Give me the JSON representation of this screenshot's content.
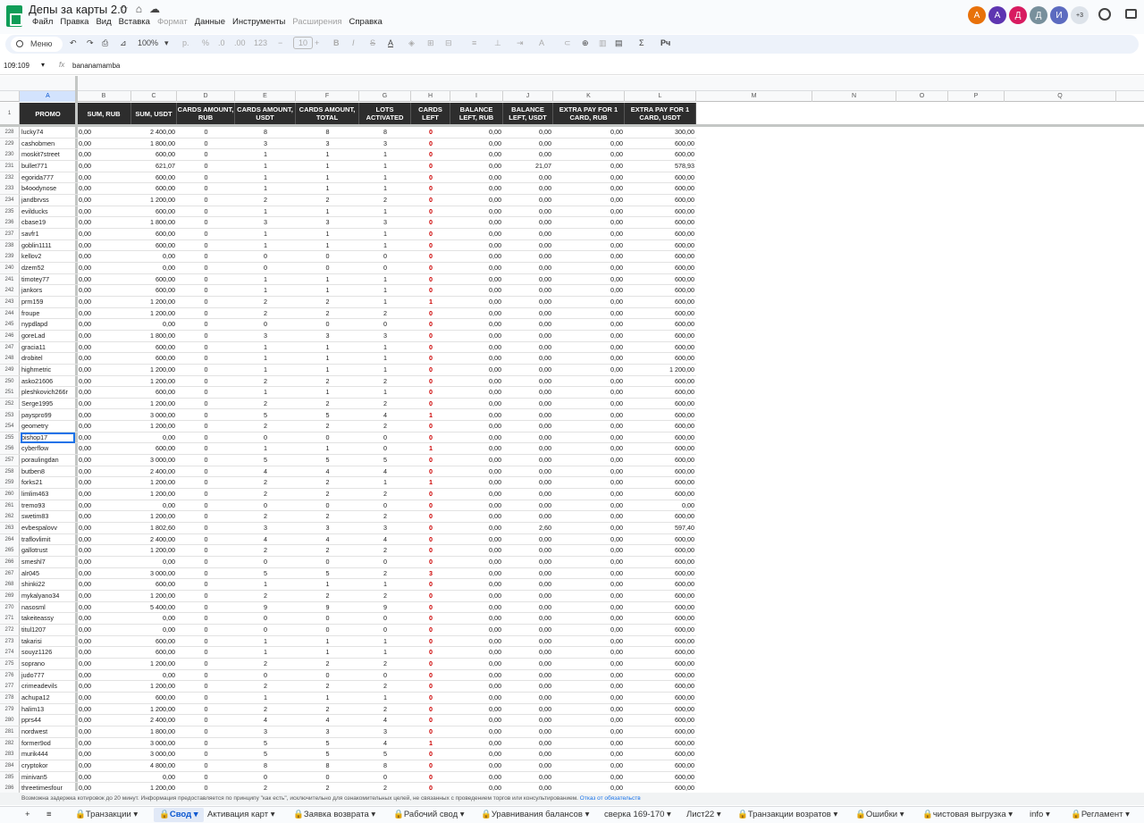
{
  "doc": {
    "title": "Депы за карты 2.0"
  },
  "menu": [
    "Файл",
    "Правка",
    "Вид",
    "Вставка",
    "Формат",
    "Данные",
    "Инструменты",
    "Расширения",
    "Справка"
  ],
  "menu_disabled": [
    "Формат",
    "Расширения"
  ],
  "avatars": [
    {
      "letter": "A",
      "color": "#e8710a"
    },
    {
      "letter": "A",
      "color": "#5e35b1"
    },
    {
      "letter": "Д",
      "color": "#d81b60"
    },
    {
      "letter": "Д",
      "color": "#78909c"
    },
    {
      "letter": "И",
      "color": "#5c6bc0"
    },
    {
      "letter": "+3",
      "color": "#dde3ea"
    }
  ],
  "toolbar": {
    "search_label": "Меню",
    "zoom": "100%",
    "currency": "р.",
    "percent": "%",
    "dec_dec": ".0",
    "inc_dec": ".00",
    "format_123": "123",
    "font_size": "10",
    "functions": "Σ",
    "input_tools": "Рч"
  },
  "formula_bar": {
    "name_box": "109:109",
    "fx": "fx",
    "value": "bananamamba"
  },
  "columns": [
    "A",
    "B",
    "C",
    "D",
    "E",
    "F",
    "G",
    "H",
    "I",
    "J",
    "K",
    "L",
    "M",
    "N",
    "O",
    "P",
    "Q"
  ],
  "header_row_number": "1",
  "headers": [
    "PROMO",
    "SUM, RUB",
    "SUM, USDT",
    "CARDS AMOUNT, RUB",
    "CARDS AMOUNT, USDT",
    "CARDS AMOUNT, TOTAL",
    "LOTS ACTIVATED",
    "CARDS LEFT",
    "BALANCE LEFT, RUB",
    "BALANCE LEFT, USDT",
    "EXTRA PAY FOR 1 CARD, RUB",
    "EXTRA PAY FOR 1 CARD, USDT"
  ],
  "rows": [
    [
      "228",
      "lucky74",
      "0,00",
      "2 400,00",
      "0",
      "8",
      "8",
      "8",
      "0",
      "0,00",
      "0,00",
      "0,00",
      "300,00"
    ],
    [
      "229",
      "cashobmen",
      "0,00",
      "1 800,00",
      "0",
      "3",
      "3",
      "3",
      "0",
      "0,00",
      "0,00",
      "0,00",
      "600,00"
    ],
    [
      "230",
      "moskit7street",
      "0,00",
      "600,00",
      "0",
      "1",
      "1",
      "1",
      "0",
      "0,00",
      "0,00",
      "0,00",
      "600,00"
    ],
    [
      "231",
      "bullet771",
      "0,00",
      "621,07",
      "0",
      "1",
      "1",
      "1",
      "0",
      "0,00",
      "21,07",
      "0,00",
      "578,93"
    ],
    [
      "232",
      "egorida777",
      "0,00",
      "600,00",
      "0",
      "1",
      "1",
      "1",
      "0",
      "0,00",
      "0,00",
      "0,00",
      "600,00"
    ],
    [
      "233",
      "b4oodynose",
      "0,00",
      "600,00",
      "0",
      "1",
      "1",
      "1",
      "0",
      "0,00",
      "0,00",
      "0,00",
      "600,00"
    ],
    [
      "234",
      "jandbrvss",
      "0,00",
      "1 200,00",
      "0",
      "2",
      "2",
      "2",
      "0",
      "0,00",
      "0,00",
      "0,00",
      "600,00"
    ],
    [
      "235",
      "evilducks",
      "0,00",
      "600,00",
      "0",
      "1",
      "1",
      "1",
      "0",
      "0,00",
      "0,00",
      "0,00",
      "600,00"
    ],
    [
      "236",
      "cbase19",
      "0,00",
      "1 800,00",
      "0",
      "3",
      "3",
      "3",
      "0",
      "0,00",
      "0,00",
      "0,00",
      "600,00"
    ],
    [
      "237",
      "savfr1",
      "0,00",
      "600,00",
      "0",
      "1",
      "1",
      "1",
      "0",
      "0,00",
      "0,00",
      "0,00",
      "600,00"
    ],
    [
      "238",
      "goblin1111",
      "0,00",
      "600,00",
      "0",
      "1",
      "1",
      "1",
      "0",
      "0,00",
      "0,00",
      "0,00",
      "600,00"
    ],
    [
      "239",
      "kellov2",
      "0,00",
      "0,00",
      "0",
      "0",
      "0",
      "0",
      "0",
      "0,00",
      "0,00",
      "0,00",
      "600,00"
    ],
    [
      "240",
      "dzem52",
      "0,00",
      "0,00",
      "0",
      "0",
      "0",
      "0",
      "0",
      "0,00",
      "0,00",
      "0,00",
      "600,00"
    ],
    [
      "241",
      "timotey77",
      "0,00",
      "600,00",
      "0",
      "1",
      "1",
      "1",
      "0",
      "0,00",
      "0,00",
      "0,00",
      "600,00"
    ],
    [
      "242",
      "jankors",
      "0,00",
      "600,00",
      "0",
      "1",
      "1",
      "1",
      "0",
      "0,00",
      "0,00",
      "0,00",
      "600,00"
    ],
    [
      "243",
      "prm159",
      "0,00",
      "1 200,00",
      "0",
      "2",
      "2",
      "1",
      "1",
      "0,00",
      "0,00",
      "0,00",
      "600,00"
    ],
    [
      "244",
      "froupe",
      "0,00",
      "1 200,00",
      "0",
      "2",
      "2",
      "2",
      "0",
      "0,00",
      "0,00",
      "0,00",
      "600,00"
    ],
    [
      "245",
      "nypdlapd",
      "0,00",
      "0,00",
      "0",
      "0",
      "0",
      "0",
      "0",
      "0,00",
      "0,00",
      "0,00",
      "600,00"
    ],
    [
      "246",
      "goreLad",
      "0,00",
      "1 800,00",
      "0",
      "3",
      "3",
      "3",
      "0",
      "0,00",
      "0,00",
      "0,00",
      "600,00"
    ],
    [
      "247",
      "gracia11",
      "0,00",
      "600,00",
      "0",
      "1",
      "1",
      "1",
      "0",
      "0,00",
      "0,00",
      "0,00",
      "600,00"
    ],
    [
      "248",
      "drobitel",
      "0,00",
      "600,00",
      "0",
      "1",
      "1",
      "1",
      "0",
      "0,00",
      "0,00",
      "0,00",
      "600,00"
    ],
    [
      "249",
      "highmetric",
      "0,00",
      "1 200,00",
      "0",
      "1",
      "1",
      "1",
      "0",
      "0,00",
      "0,00",
      "0,00",
      "1 200,00"
    ],
    [
      "250",
      "asko21606",
      "0,00",
      "1 200,00",
      "0",
      "2",
      "2",
      "2",
      "0",
      "0,00",
      "0,00",
      "0,00",
      "600,00"
    ],
    [
      "251",
      "pleshkovich266r",
      "0,00",
      "600,00",
      "0",
      "1",
      "1",
      "1",
      "0",
      "0,00",
      "0,00",
      "0,00",
      "600,00"
    ],
    [
      "252",
      "Serge1995",
      "0,00",
      "1 200,00",
      "0",
      "2",
      "2",
      "2",
      "0",
      "0,00",
      "0,00",
      "0,00",
      "600,00"
    ],
    [
      "253",
      "payspro99",
      "0,00",
      "3 000,00",
      "0",
      "5",
      "5",
      "4",
      "1",
      "0,00",
      "0,00",
      "0,00",
      "600,00"
    ],
    [
      "254",
      "geometry",
      "0,00",
      "1 200,00",
      "0",
      "2",
      "2",
      "2",
      "0",
      "0,00",
      "0,00",
      "0,00",
      "600,00"
    ],
    [
      "255",
      "bishop17",
      "0,00",
      "0,00",
      "0",
      "0",
      "0",
      "0",
      "0",
      "0,00",
      "0,00",
      "0,00",
      "600,00"
    ],
    [
      "256",
      "cyberflow",
      "0,00",
      "600,00",
      "0",
      "1",
      "1",
      "0",
      "1",
      "0,00",
      "0,00",
      "0,00",
      "600,00"
    ],
    [
      "257",
      "poraulingdan",
      "0,00",
      "3 000,00",
      "0",
      "5",
      "5",
      "5",
      "0",
      "0,00",
      "0,00",
      "0,00",
      "600,00"
    ],
    [
      "258",
      "butben8",
      "0,00",
      "2 400,00",
      "0",
      "4",
      "4",
      "4",
      "0",
      "0,00",
      "0,00",
      "0,00",
      "600,00"
    ],
    [
      "259",
      "forks21",
      "0,00",
      "1 200,00",
      "0",
      "2",
      "2",
      "1",
      "1",
      "0,00",
      "0,00",
      "0,00",
      "600,00"
    ],
    [
      "260",
      "limlim463",
      "0,00",
      "1 200,00",
      "0",
      "2",
      "2",
      "2",
      "0",
      "0,00",
      "0,00",
      "0,00",
      "600,00"
    ],
    [
      "261",
      "tremo93",
      "0,00",
      "0,00",
      "0",
      "0",
      "0",
      "0",
      "0",
      "0,00",
      "0,00",
      "0,00",
      "0,00"
    ],
    [
      "262",
      "swetim83",
      "0,00",
      "1 200,00",
      "0",
      "2",
      "2",
      "2",
      "0",
      "0,00",
      "0,00",
      "0,00",
      "600,00"
    ],
    [
      "263",
      "evbespalovv",
      "0,00",
      "1 802,60",
      "0",
      "3",
      "3",
      "3",
      "0",
      "0,00",
      "2,60",
      "0,00",
      "597,40"
    ],
    [
      "264",
      "traflovlimit",
      "0,00",
      "2 400,00",
      "0",
      "4",
      "4",
      "4",
      "0",
      "0,00",
      "0,00",
      "0,00",
      "600,00"
    ],
    [
      "265",
      "gallotrust",
      "0,00",
      "1 200,00",
      "0",
      "2",
      "2",
      "2",
      "0",
      "0,00",
      "0,00",
      "0,00",
      "600,00"
    ],
    [
      "266",
      "smeshl7",
      "0,00",
      "0,00",
      "0",
      "0",
      "0",
      "0",
      "0",
      "0,00",
      "0,00",
      "0,00",
      "600,00"
    ],
    [
      "267",
      "alr045",
      "0,00",
      "3 000,00",
      "0",
      "5",
      "5",
      "2",
      "3",
      "0,00",
      "0,00",
      "0,00",
      "600,00"
    ],
    [
      "268",
      "shinki22",
      "0,00",
      "600,00",
      "0",
      "1",
      "1",
      "1",
      "0",
      "0,00",
      "0,00",
      "0,00",
      "600,00"
    ],
    [
      "269",
      "mykalyano34",
      "0,00",
      "1 200,00",
      "0",
      "2",
      "2",
      "2",
      "0",
      "0,00",
      "0,00",
      "0,00",
      "600,00"
    ],
    [
      "270",
      "nasosml",
      "0,00",
      "5 400,00",
      "0",
      "9",
      "9",
      "9",
      "0",
      "0,00",
      "0,00",
      "0,00",
      "600,00"
    ],
    [
      "271",
      "takeiteassy",
      "0,00",
      "0,00",
      "0",
      "0",
      "0",
      "0",
      "0",
      "0,00",
      "0,00",
      "0,00",
      "600,00"
    ],
    [
      "272",
      "titul1207",
      "0,00",
      "0,00",
      "0",
      "0",
      "0",
      "0",
      "0",
      "0,00",
      "0,00",
      "0,00",
      "600,00"
    ],
    [
      "273",
      "takarisi",
      "0,00",
      "600,00",
      "0",
      "1",
      "1",
      "1",
      "0",
      "0,00",
      "0,00",
      "0,00",
      "600,00"
    ],
    [
      "274",
      "souyz1126",
      "0,00",
      "600,00",
      "0",
      "1",
      "1",
      "1",
      "0",
      "0,00",
      "0,00",
      "0,00",
      "600,00"
    ],
    [
      "275",
      "soprano",
      "0,00",
      "1 200,00",
      "0",
      "2",
      "2",
      "2",
      "0",
      "0,00",
      "0,00",
      "0,00",
      "600,00"
    ],
    [
      "276",
      "judo777",
      "0,00",
      "0,00",
      "0",
      "0",
      "0",
      "0",
      "0",
      "0,00",
      "0,00",
      "0,00",
      "600,00"
    ],
    [
      "277",
      "crimeadevils",
      "0,00",
      "1 200,00",
      "0",
      "2",
      "2",
      "2",
      "0",
      "0,00",
      "0,00",
      "0,00",
      "600,00"
    ],
    [
      "278",
      "achupa12",
      "0,00",
      "600,00",
      "0",
      "1",
      "1",
      "1",
      "0",
      "0,00",
      "0,00",
      "0,00",
      "600,00"
    ],
    [
      "279",
      "halim13",
      "0,00",
      "1 200,00",
      "0",
      "2",
      "2",
      "2",
      "0",
      "0,00",
      "0,00",
      "0,00",
      "600,00"
    ],
    [
      "280",
      "pprs44",
      "0,00",
      "2 400,00",
      "0",
      "4",
      "4",
      "4",
      "0",
      "0,00",
      "0,00",
      "0,00",
      "600,00"
    ],
    [
      "281",
      "nordwest",
      "0,00",
      "1 800,00",
      "0",
      "3",
      "3",
      "3",
      "0",
      "0,00",
      "0,00",
      "0,00",
      "600,00"
    ],
    [
      "282",
      "former9od",
      "0,00",
      "3 000,00",
      "0",
      "5",
      "5",
      "4",
      "1",
      "0,00",
      "0,00",
      "0,00",
      "600,00"
    ],
    [
      "283",
      "murik444",
      "0,00",
      "3 000,00",
      "0",
      "5",
      "5",
      "5",
      "0",
      "0,00",
      "0,00",
      "0,00",
      "600,00"
    ],
    [
      "284",
      "cryptokor",
      "0,00",
      "4 800,00",
      "0",
      "8",
      "8",
      "8",
      "0",
      "0,00",
      "0,00",
      "0,00",
      "600,00"
    ],
    [
      "285",
      "minivan5",
      "0,00",
      "0,00",
      "0",
      "0",
      "0",
      "0",
      "0",
      "0,00",
      "0,00",
      "0,00",
      "600,00"
    ],
    [
      "286",
      "threetimesfour",
      "0,00",
      "1 200,00",
      "0",
      "2",
      "2",
      "2",
      "0",
      "0,00",
      "0,00",
      "0,00",
      "600,00"
    ]
  ],
  "selected_row": "255",
  "notice": {
    "text": "Возможна задержка котировок до 20 минут. Информация предоставляется по принципу \"как есть\", исключительно для ознакомительных целей, не связанных с проведением торгов или консультированием.",
    "link": "Отказ от обязательств"
  },
  "tabs": [
    {
      "label": "Транзакции",
      "locked": true
    },
    {
      "label": "Свод",
      "locked": true,
      "active": true
    },
    {
      "label": "Активация карт",
      "locked": false
    },
    {
      "label": "Заявка возврата",
      "locked": true
    },
    {
      "label": "Рабочий свод",
      "locked": true
    },
    {
      "label": "Уравнивания балансов",
      "locked": true
    },
    {
      "label": "сверка 169-170",
      "locked": false
    },
    {
      "label": "Лист22",
      "locked": false
    },
    {
      "label": "Транзакции возратов",
      "locked": true
    },
    {
      "label": "Ошибки",
      "locked": true
    },
    {
      "label": "чистовая выгрузка",
      "locked": true
    },
    {
      "label": "info",
      "locked": false
    },
    {
      "label": "Регламент",
      "locked": true
    }
  ]
}
